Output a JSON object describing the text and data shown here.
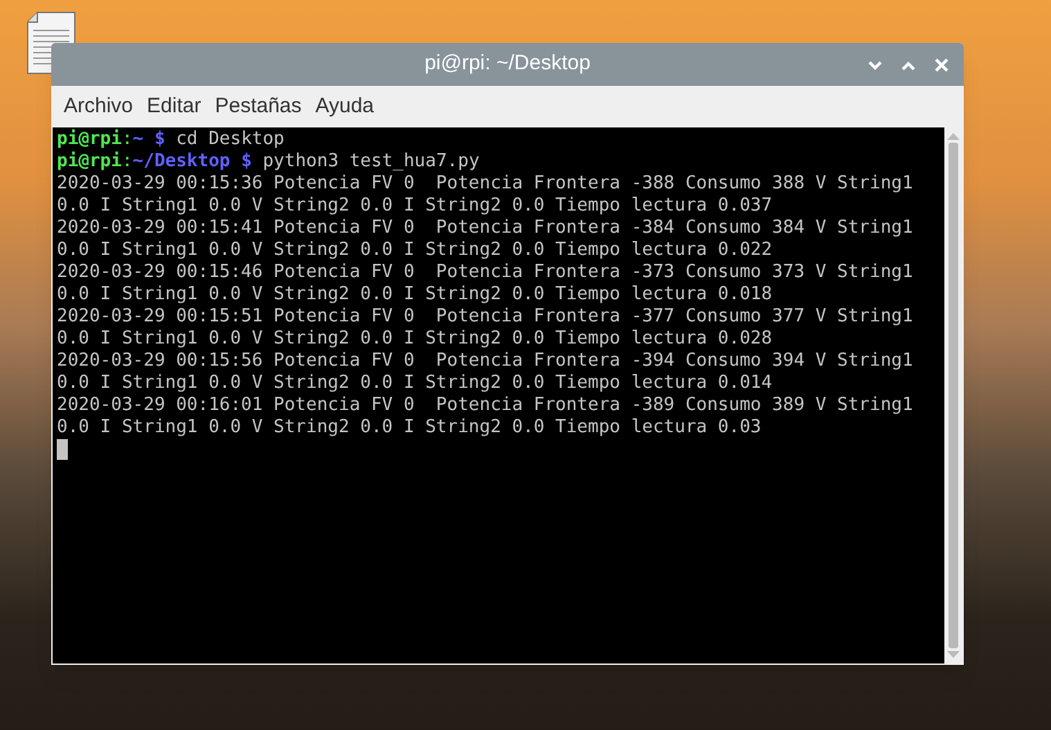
{
  "window": {
    "title": "pi@rpi: ~/Desktop"
  },
  "menu": [
    "Archivo",
    "Editar",
    "Pestañas",
    "Ayuda"
  ],
  "terminal": {
    "lines": [
      {
        "kind": "prompt",
        "user": "pi@rpi",
        "separator": ":",
        "path": "~",
        "symbol": "$",
        "command": "cd Desktop"
      },
      {
        "kind": "prompt",
        "user": "pi@rpi",
        "separator": ":",
        "path": "~/Desktop",
        "symbol": "$",
        "command": "python3 test_hua7.py"
      },
      {
        "kind": "output",
        "text": "2020-03-29 00:15:36 Potencia FV 0  Potencia Frontera -388 Consumo 388 V String1"
      },
      {
        "kind": "output",
        "text": "0.0 I String1 0.0 V String2 0.0 I String2 0.0 Tiempo lectura 0.037"
      },
      {
        "kind": "output",
        "text": "2020-03-29 00:15:41 Potencia FV 0  Potencia Frontera -384 Consumo 384 V String1"
      },
      {
        "kind": "output",
        "text": "0.0 I String1 0.0 V String2 0.0 I String2 0.0 Tiempo lectura 0.022"
      },
      {
        "kind": "output",
        "text": "2020-03-29 00:15:46 Potencia FV 0  Potencia Frontera -373 Consumo 373 V String1"
      },
      {
        "kind": "output",
        "text": "0.0 I String1 0.0 V String2 0.0 I String2 0.0 Tiempo lectura 0.018"
      },
      {
        "kind": "output",
        "text": "2020-03-29 00:15:51 Potencia FV 0  Potencia Frontera -377 Consumo 377 V String1"
      },
      {
        "kind": "output",
        "text": "0.0 I String1 0.0 V String2 0.0 I String2 0.0 Tiempo lectura 0.028"
      },
      {
        "kind": "output",
        "text": "2020-03-29 00:15:56 Potencia FV 0  Potencia Frontera -394 Consumo 394 V String1"
      },
      {
        "kind": "output",
        "text": "0.0 I String1 0.0 V String2 0.0 I String2 0.0 Tiempo lectura 0.014"
      },
      {
        "kind": "output",
        "text": "2020-03-29 00:16:01 Potencia FV 0  Potencia Frontera -389 Consumo 389 V String1"
      },
      {
        "kind": "output",
        "text": "0.0 I String1 0.0 V String2 0.0 I String2 0.0 Tiempo lectura 0.03"
      },
      {
        "kind": "cursor"
      }
    ]
  }
}
